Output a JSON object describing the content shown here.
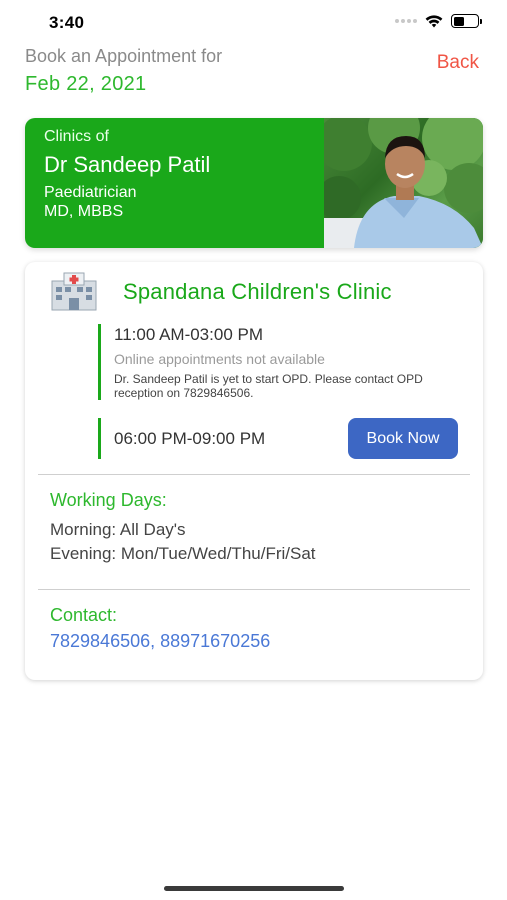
{
  "status_bar": {
    "time": "3:40"
  },
  "header": {
    "prefix": "Book an Appointment for",
    "date": "Feb 22, 2021",
    "back_label": "Back"
  },
  "doctor": {
    "clinics_of": "Clinics of",
    "name": "Dr Sandeep Patil",
    "specialty": "Paediatrician",
    "degree": "MD, MBBS"
  },
  "clinic": {
    "name": "Spandana Children's Clinic",
    "icon": "hospital-icon",
    "slots": [
      {
        "time": "11:00 AM-03:00 PM",
        "status": "Online appointments not available",
        "note": "Dr. Sandeep Patil is yet to start OPD. Please contact OPD reception on 7829846506."
      },
      {
        "time": "06:00 PM-09:00 PM",
        "button_label": "Book Now"
      }
    ],
    "working_days": {
      "title": "Working Days:",
      "morning": "Morning: All Day's",
      "evening": "Evening: Mon/Tue/Wed/Thu/Fri/Sat"
    },
    "contact": {
      "title": "Contact:",
      "numbers": "7829846506, 88971670256"
    }
  },
  "colors": {
    "brand_green": "#1aa81a",
    "text_green": "#2eb82e",
    "back_red": "#f05545",
    "button_blue": "#3d67c4",
    "link_blue": "#4a78d6"
  }
}
